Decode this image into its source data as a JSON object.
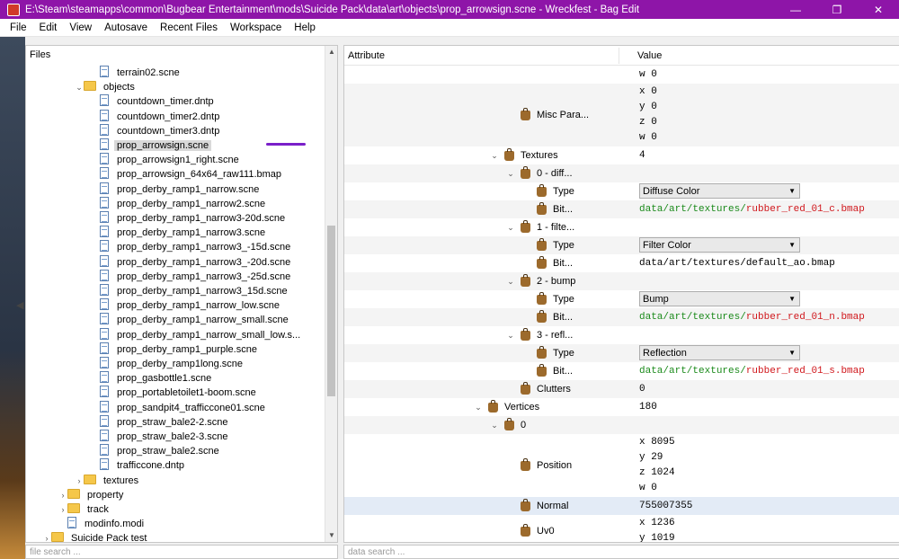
{
  "window": {
    "title": "E:\\Steam\\steamapps\\common\\Bugbear Entertainment\\mods\\Suicide Pack\\data\\art\\objects\\prop_arrowsign.scne - Wreckfest - Bag Edit",
    "minimize": "—",
    "maximize": "❐",
    "close": "✕"
  },
  "menu": [
    "File",
    "Edit",
    "View",
    "Autosave",
    "Recent Files",
    "Workspace",
    "Help"
  ],
  "files": {
    "header": "Files",
    "search_placeholder": "file search ...",
    "tree": [
      {
        "label": "terrain02.scne",
        "type": "file",
        "depth": 5
      },
      {
        "label": "objects",
        "type": "folder",
        "depth": 4,
        "expanded": true
      },
      {
        "label": "countdown_timer.dntp",
        "type": "file",
        "depth": 5
      },
      {
        "label": "countdown_timer2.dntp",
        "type": "file",
        "depth": 5
      },
      {
        "label": "countdown_timer3.dntp",
        "type": "file",
        "depth": 5
      },
      {
        "label": "prop_arrowsign.scne",
        "type": "file",
        "depth": 5,
        "selected": true
      },
      {
        "label": "prop_arrowsign1_right.scne",
        "type": "file",
        "depth": 5
      },
      {
        "label": "prop_arrowsign_64x64_raw111.bmap",
        "type": "file",
        "depth": 5
      },
      {
        "label": "prop_derby_ramp1_narrow.scne",
        "type": "file",
        "depth": 5
      },
      {
        "label": "prop_derby_ramp1_narrow2.scne",
        "type": "file",
        "depth": 5
      },
      {
        "label": "prop_derby_ramp1_narrow3-20d.scne",
        "type": "file",
        "depth": 5
      },
      {
        "label": "prop_derby_ramp1_narrow3.scne",
        "type": "file",
        "depth": 5
      },
      {
        "label": "prop_derby_ramp1_narrow3_-15d.scne",
        "type": "file",
        "depth": 5
      },
      {
        "label": "prop_derby_ramp1_narrow3_-20d.scne",
        "type": "file",
        "depth": 5
      },
      {
        "label": "prop_derby_ramp1_narrow3_-25d.scne",
        "type": "file",
        "depth": 5
      },
      {
        "label": "prop_derby_ramp1_narrow3_15d.scne",
        "type": "file",
        "depth": 5
      },
      {
        "label": "prop_derby_ramp1_narrow_low.scne",
        "type": "file",
        "depth": 5
      },
      {
        "label": "prop_derby_ramp1_narrow_small.scne",
        "type": "file",
        "depth": 5
      },
      {
        "label": "prop_derby_ramp1_narrow_small_low.s...",
        "type": "file",
        "depth": 5
      },
      {
        "label": "prop_derby_ramp1_purple.scne",
        "type": "file",
        "depth": 5
      },
      {
        "label": "prop_derby_ramp1long.scne",
        "type": "file",
        "depth": 5
      },
      {
        "label": "prop_gasbottle1.scne",
        "type": "file",
        "depth": 5
      },
      {
        "label": "prop_portabletoilet1-boom.scne",
        "type": "file",
        "depth": 5
      },
      {
        "label": "prop_sandpit4_trafficcone01.scne",
        "type": "file",
        "depth": 5
      },
      {
        "label": "prop_straw_bale2-2.scne",
        "type": "file",
        "depth": 5
      },
      {
        "label": "prop_straw_bale2-3.scne",
        "type": "file",
        "depth": 5
      },
      {
        "label": "prop_straw_bale2.scne",
        "type": "file",
        "depth": 5
      },
      {
        "label": "trafficcone.dntp",
        "type": "file",
        "depth": 5
      },
      {
        "label": "textures",
        "type": "folder",
        "depth": 4,
        "expanded": false
      },
      {
        "label": "property",
        "type": "folder",
        "depth": 3,
        "expanded": false
      },
      {
        "label": "track",
        "type": "folder",
        "depth": 3,
        "expanded": false
      },
      {
        "label": "modinfo.modi",
        "type": "file",
        "depth": 3
      },
      {
        "label": "Suicide Pack test",
        "type": "folder",
        "depth": 2,
        "expanded": false
      }
    ]
  },
  "props": {
    "header_attribute": "Attribute",
    "header_value": "Value",
    "search_placeholder": "data search ...",
    "rows": [
      {
        "attr": "",
        "values": [
          "w 0"
        ],
        "kind": "plain",
        "depth": 0
      },
      {
        "attr": "Misc Para...",
        "values": [
          "x 0",
          "y 0",
          "z 0",
          "w 0"
        ],
        "kind": "plain",
        "depth": 10
      },
      {
        "attr": "Textures",
        "values": [
          "4"
        ],
        "kind": "plain",
        "depth": 9,
        "chevron": "open"
      },
      {
        "attr": "0 - diff...",
        "values": [],
        "kind": "plain",
        "depth": 10,
        "chevron": "open"
      },
      {
        "attr": "Type",
        "values": [
          "Diffuse Color"
        ],
        "kind": "combo",
        "depth": 11
      },
      {
        "attr": "Bit...",
        "values": [
          "data/art/textures/",
          "rubber_red_01_c.bmap"
        ],
        "kind": "path-gr",
        "depth": 11
      },
      {
        "attr": "1 - filte...",
        "values": [],
        "kind": "plain",
        "depth": 10,
        "chevron": "open"
      },
      {
        "attr": "Type",
        "values": [
          "Filter Color"
        ],
        "kind": "combo",
        "depth": 11
      },
      {
        "attr": "Bit...",
        "values": [
          "data/art/textures/default_ao.bmap"
        ],
        "kind": "plain",
        "depth": 11
      },
      {
        "attr": "2 - bump",
        "values": [],
        "kind": "plain",
        "depth": 10,
        "chevron": "open"
      },
      {
        "attr": "Type",
        "values": [
          "Bump"
        ],
        "kind": "combo",
        "depth": 11
      },
      {
        "attr": "Bit...",
        "values": [
          "data/art/textures/",
          "rubber_red_01_n.bmap"
        ],
        "kind": "path-gr",
        "depth": 11
      },
      {
        "attr": "3 - refl...",
        "values": [],
        "kind": "plain",
        "depth": 10,
        "chevron": "open"
      },
      {
        "attr": "Type",
        "values": [
          "Reflection"
        ],
        "kind": "combo",
        "depth": 11
      },
      {
        "attr": "Bit...",
        "values": [
          "data/art/textures/",
          "rubber_red_01_s.bmap"
        ],
        "kind": "path-gr",
        "depth": 11
      },
      {
        "attr": "Clutters",
        "values": [
          "0"
        ],
        "kind": "plain",
        "depth": 10
      },
      {
        "attr": "Vertices",
        "values": [
          "180"
        ],
        "kind": "plain",
        "depth": 8,
        "chevron": "open"
      },
      {
        "attr": "0",
        "values": [],
        "kind": "plain",
        "depth": 9,
        "chevron": "open"
      },
      {
        "attr": "Position",
        "values": [
          "x 8095",
          "y 29",
          "z 1024",
          "w 0"
        ],
        "kind": "plain",
        "depth": 10
      },
      {
        "attr": "Normal",
        "values": [
          "755007355"
        ],
        "kind": "plain",
        "depth": 10,
        "highlight": true
      },
      {
        "attr": "Uv0",
        "values": [
          "x 1236",
          "y 1019"
        ],
        "kind": "plain",
        "depth": 10
      }
    ]
  }
}
